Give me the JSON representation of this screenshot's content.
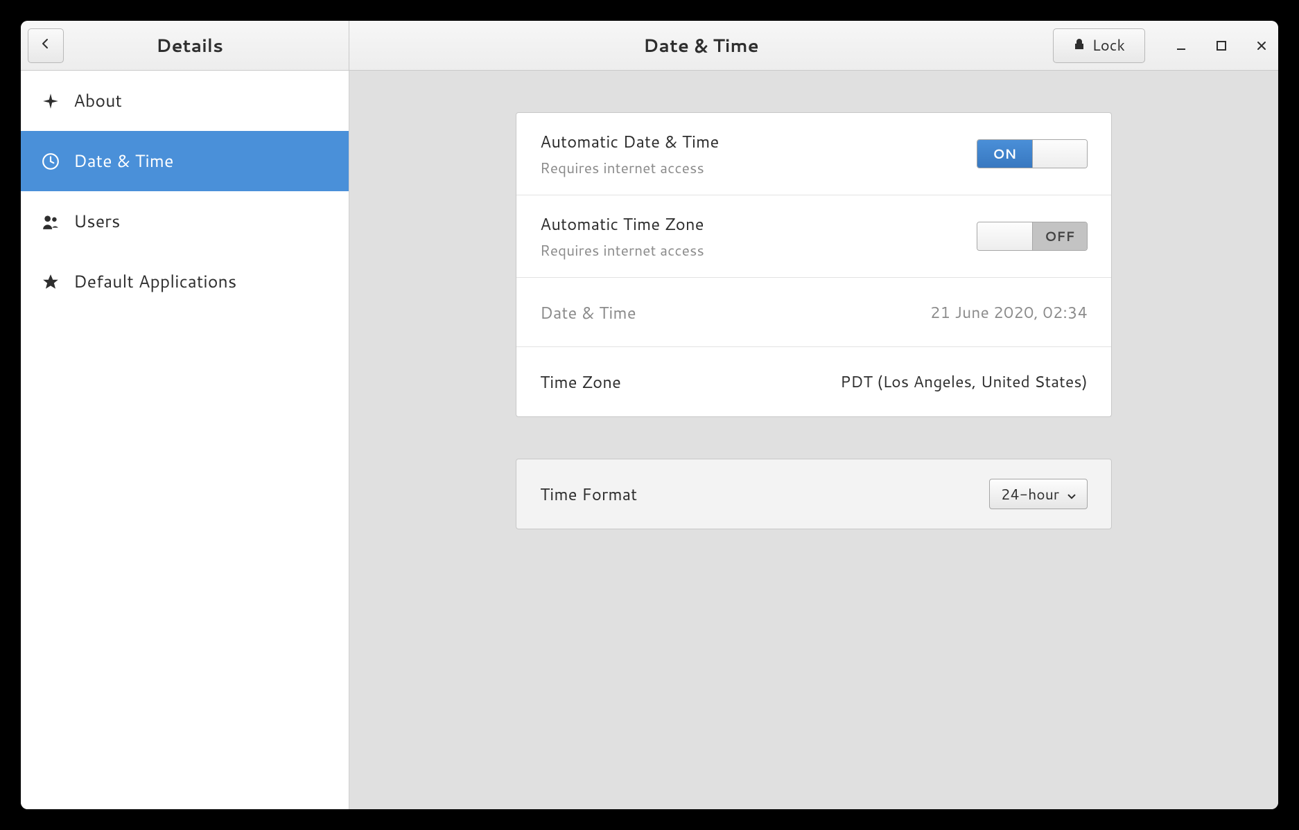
{
  "header": {
    "sidebar_title": "Details",
    "main_title": "Date & Time",
    "lock_label": "Lock"
  },
  "sidebar": {
    "items": [
      {
        "label": "About",
        "active": false
      },
      {
        "label": "Date & Time",
        "active": true
      },
      {
        "label": "Users",
        "active": false
      },
      {
        "label": "Default Applications",
        "active": false
      }
    ]
  },
  "settings": {
    "auto_datetime": {
      "title": "Automatic Date & Time",
      "subtitle": "Requires internet access",
      "on_label": "ON",
      "state": "on"
    },
    "auto_timezone": {
      "title": "Automatic Time Zone",
      "subtitle": "Requires internet access",
      "off_label": "OFF",
      "state": "off"
    },
    "datetime": {
      "title": "Date & Time",
      "value": "21 June 2020, 02:34"
    },
    "timezone": {
      "title": "Time Zone",
      "value": "PDT (Los Angeles, United States)"
    },
    "time_format": {
      "title": "Time Format",
      "value": "24-hour"
    }
  }
}
